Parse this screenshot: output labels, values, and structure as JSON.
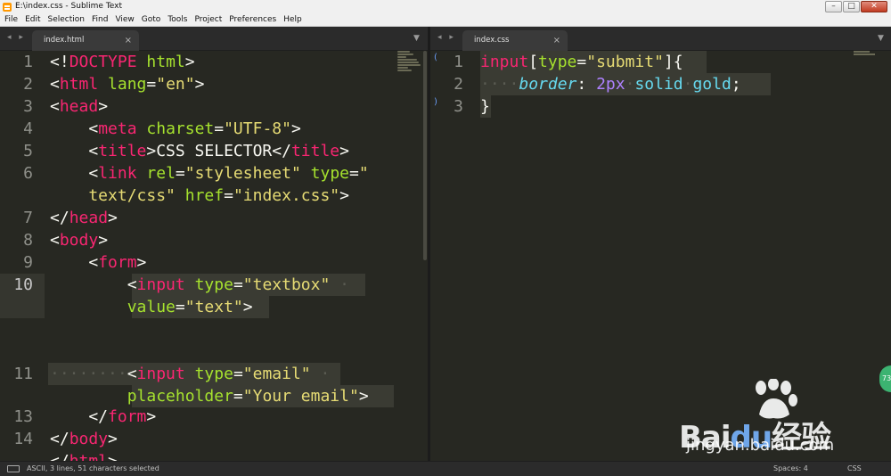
{
  "window": {
    "title": "E:\\index.css - Sublime Text",
    "controls": [
      "–",
      "□",
      "✕"
    ]
  },
  "menu": [
    "File",
    "Edit",
    "Selection",
    "Find",
    "View",
    "Goto",
    "Tools",
    "Project",
    "Preferences",
    "Help"
  ],
  "tabs": {
    "left": {
      "label": "index.html",
      "close": "×"
    },
    "right": {
      "label": "index.css",
      "close": "×"
    }
  },
  "nav": {
    "arrows": "◂ ▸",
    "dropdown": "▼"
  },
  "left_lines": [
    "1",
    "2",
    "3",
    "4",
    "5",
    "6",
    "7",
    "8",
    "9",
    "10",
    "11",
    "12",
    "13",
    "14"
  ],
  "right_lines": [
    "1",
    "2",
    "3"
  ],
  "status": {
    "left": "ASCII, 3 lines, 51 characters selected",
    "spaces": "Spaces: 4",
    "syntax": "CSS"
  },
  "watermark": {
    "brand_left": "Bai",
    "brand_right": "经验",
    "url": "jingyan.baidu.com",
    "badge": "73"
  },
  "colors": {
    "editor_bg": "#272822",
    "tag": "#f92672",
    "attribute": "#a6e22e",
    "string": "#e6db74",
    "property": "#66d9ef",
    "number": "#ae81ff"
  }
}
